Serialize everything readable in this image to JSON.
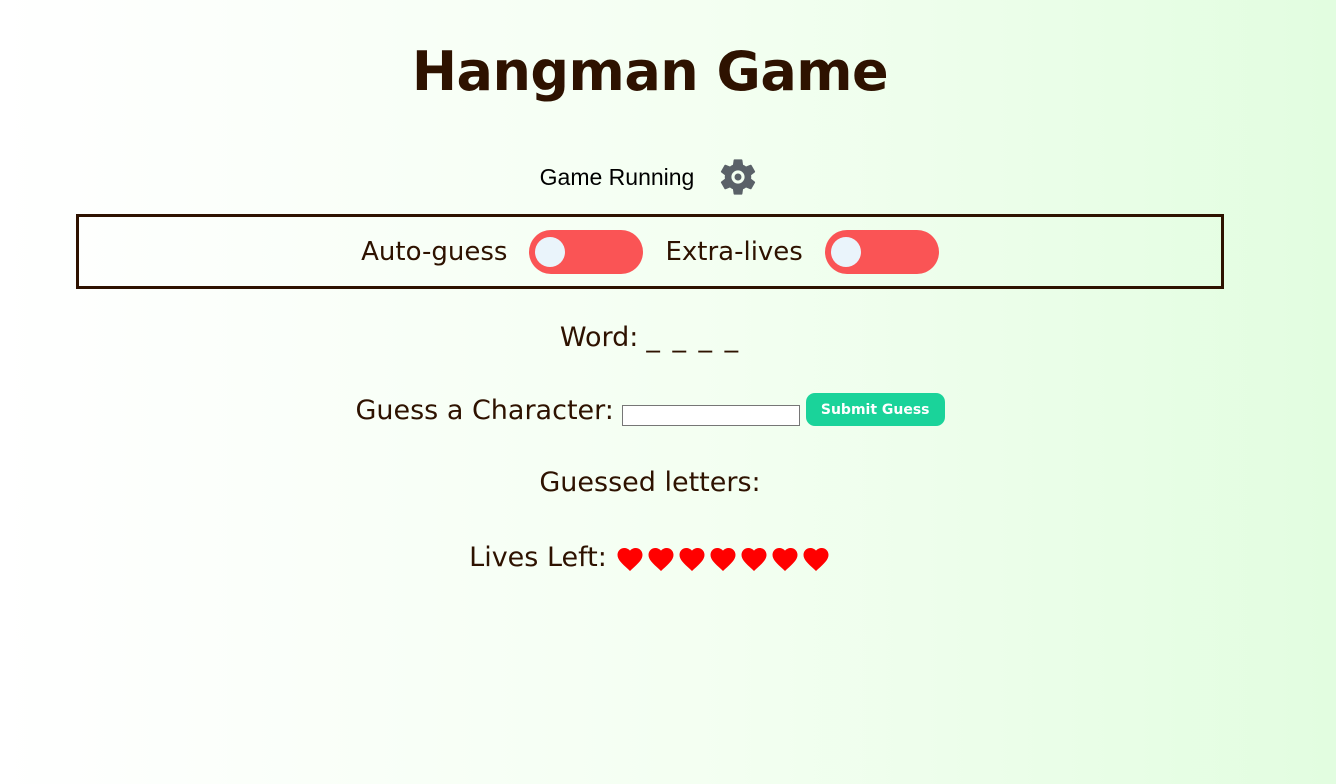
{
  "title": "Hangman Game",
  "status": {
    "text": "Game Running",
    "settings_icon": "gear-icon"
  },
  "toggles": [
    {
      "label": "Auto-guess",
      "on": false
    },
    {
      "label": "Extra-lives",
      "on": false
    }
  ],
  "word": {
    "label": "Word:",
    "value": "_ _ _ _"
  },
  "guess": {
    "label": "Guess a Character:",
    "input_value": "",
    "submit_label": "Submit Guess"
  },
  "guessed": {
    "label": "Guessed letters:",
    "value": ""
  },
  "lives": {
    "label": "Lives Left:",
    "count": 7,
    "icon": "heart-icon"
  },
  "colors": {
    "text": "#2e1200",
    "toggle_off": "#fa5455",
    "submit": "#1ad39a",
    "heart": "#ff0000",
    "gear": "#5a6168"
  }
}
